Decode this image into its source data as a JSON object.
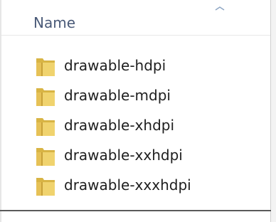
{
  "column_header": {
    "label": "Name",
    "sort_icon": "sort-ascending-icon"
  },
  "files": [
    {
      "name": "drawable-hdpi",
      "icon": "folder-icon"
    },
    {
      "name": "drawable-mdpi",
      "icon": "folder-icon"
    },
    {
      "name": "drawable-xhdpi",
      "icon": "folder-icon"
    },
    {
      "name": "drawable-xxhdpi",
      "icon": "folder-icon"
    },
    {
      "name": "drawable-xxxhdpi",
      "icon": "folder-icon"
    }
  ],
  "colors": {
    "header_text": "#4a5a78",
    "folder": "#e8c860"
  }
}
